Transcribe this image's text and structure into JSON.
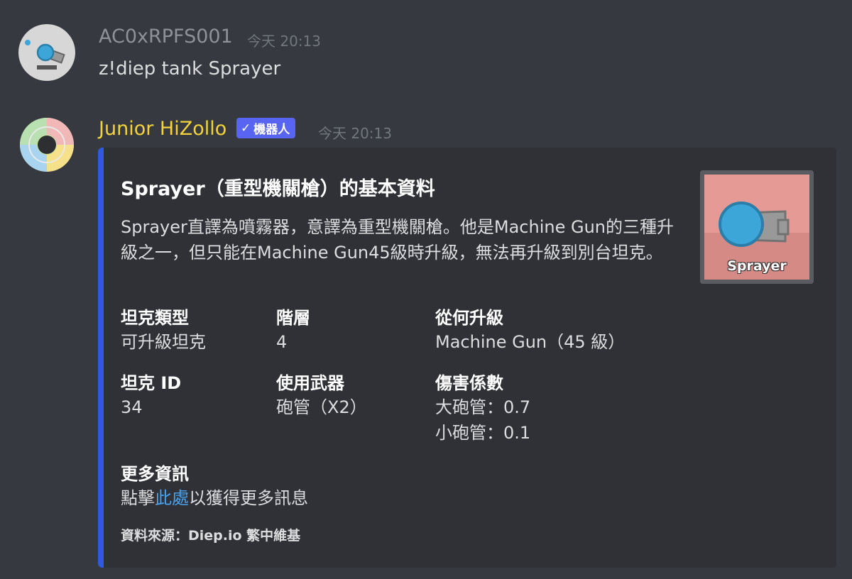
{
  "messages": [
    {
      "author": "AC0xRPFS001",
      "author_color": "#8e9297",
      "timestamp": "今天 20:13",
      "content": "z!diep tank Sprayer"
    },
    {
      "author": "Junior HiZollo",
      "author_color": "#f3d33b",
      "bot_tag": "機器人",
      "timestamp": "今天 20:13"
    }
  ],
  "embed": {
    "accent_color": "#2e5bde",
    "title": "Sprayer（重型機關槍）的基本資料",
    "description": "Sprayer直譯為噴霧器，意譯為重型機關槍。他是Machine Gun的三種升級之一，但只能在Machine Gun45級時升級，無法再升級到別台坦克。",
    "thumbnail_label": "Sprayer",
    "fields": {
      "tank_type": {
        "name": "坦克類型",
        "value": "可升級坦克"
      },
      "tier": {
        "name": "階層",
        "value": "4"
      },
      "upgrade_from": {
        "name": "從何升級",
        "value": "Machine Gun（45 級）"
      },
      "tank_id": {
        "name": "坦克 ID",
        "value": "34"
      },
      "weapons": {
        "name": "使用武器",
        "value": "砲管（X2）"
      },
      "damage": {
        "name": "傷害係數",
        "line1": "大砲管：0.7",
        "line2": "小砲管：0.1"
      }
    },
    "more_info": {
      "name": "更多資訊",
      "prefix": "點擊",
      "link": "此處",
      "suffix": "以獲得更多訊息"
    },
    "footer": "資料來源：Diep.io 繁中維基"
  }
}
